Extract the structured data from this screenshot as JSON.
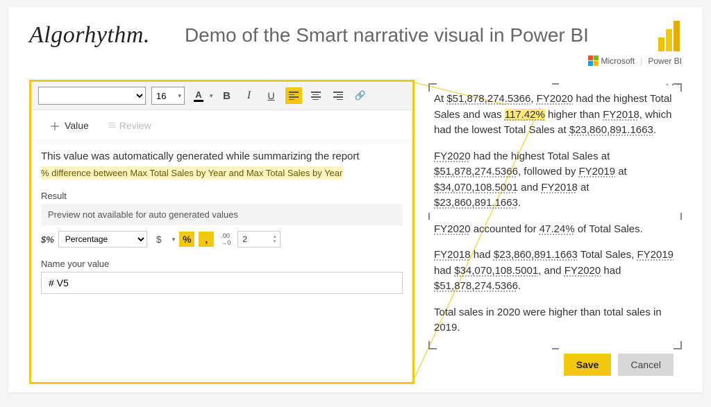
{
  "header": {
    "logo": "Algorhythm.",
    "title": "Demo of the Smart narrative visual in Power BI",
    "brand_ms": "Microsoft",
    "brand_pbi": "Power BI"
  },
  "toolbar": {
    "font_size": "16",
    "bold": "B",
    "italic": "I",
    "underline": "U",
    "text_color_glyph": "A",
    "link_glyph": "🔗"
  },
  "tabs": {
    "value": "Value",
    "review": "Review"
  },
  "editor": {
    "auto_message": "This value was automatically generated while summarizing the report",
    "description": "% difference between Max Total Sales by Year and Max Total Sales by Year",
    "result_label": "Result",
    "preview_text": "Preview not available for auto generated values",
    "fx_glyph": "$%",
    "format_type": "Percentage",
    "dollar": "$",
    "percent": "%",
    "comma": ",",
    "decimals_glyph": ".00→0",
    "decimals_value": "2",
    "name_label": "Name your value",
    "name_value": "# V5",
    "save": "Save",
    "cancel": "Cancel"
  },
  "narrative": {
    "p1_a": "At ",
    "p1_v1": "$51,878,274.5366",
    "p1_b": ", ",
    "p1_v2": "FY2020",
    "p1_c": " had the highest Total Sales and was ",
    "p1_hl": "117.42%",
    "p1_d": " higher than ",
    "p1_v3": "FY2018",
    "p1_e": ", which had the lowest Total Sales at ",
    "p1_v4": "$23,860,891.1663",
    "p1_f": ".",
    "p2_a": "",
    "p2_v1": "FY2020",
    "p2_b": " had the highest Total Sales at ",
    "p2_v2": "$51,878,274.5366",
    "p2_c": ", followed by ",
    "p2_v3": "FY2019",
    "p2_d": " at ",
    "p2_v4": "$34,070,108.5001",
    "p2_e": " and ",
    "p2_v5": "FY2018",
    "p2_f": " at ",
    "p2_v6": "$23,860,891.1663",
    "p2_g": ".",
    "p3_v1": "FY2020",
    "p3_a": " accounted for ",
    "p3_v2": "47.24%",
    "p3_b": " of Total Sales.",
    "p4_v1": "FY2018",
    "p4_a": " had ",
    "p4_v2": "$23,860,891.1663",
    "p4_b": " Total Sales, ",
    "p4_v3": "FY2019",
    "p4_c": " had ",
    "p4_v4": "$34,070,108.5001",
    "p4_d": ", and ",
    "p4_v5": "FY2020",
    "p4_e": " had ",
    "p4_v6": "$51,878,274.5366",
    "p4_f": ".",
    "p5": "Total sales in 2020 were  higher than total sales in 2019."
  },
  "colors": {
    "accent": "#f2c811"
  }
}
